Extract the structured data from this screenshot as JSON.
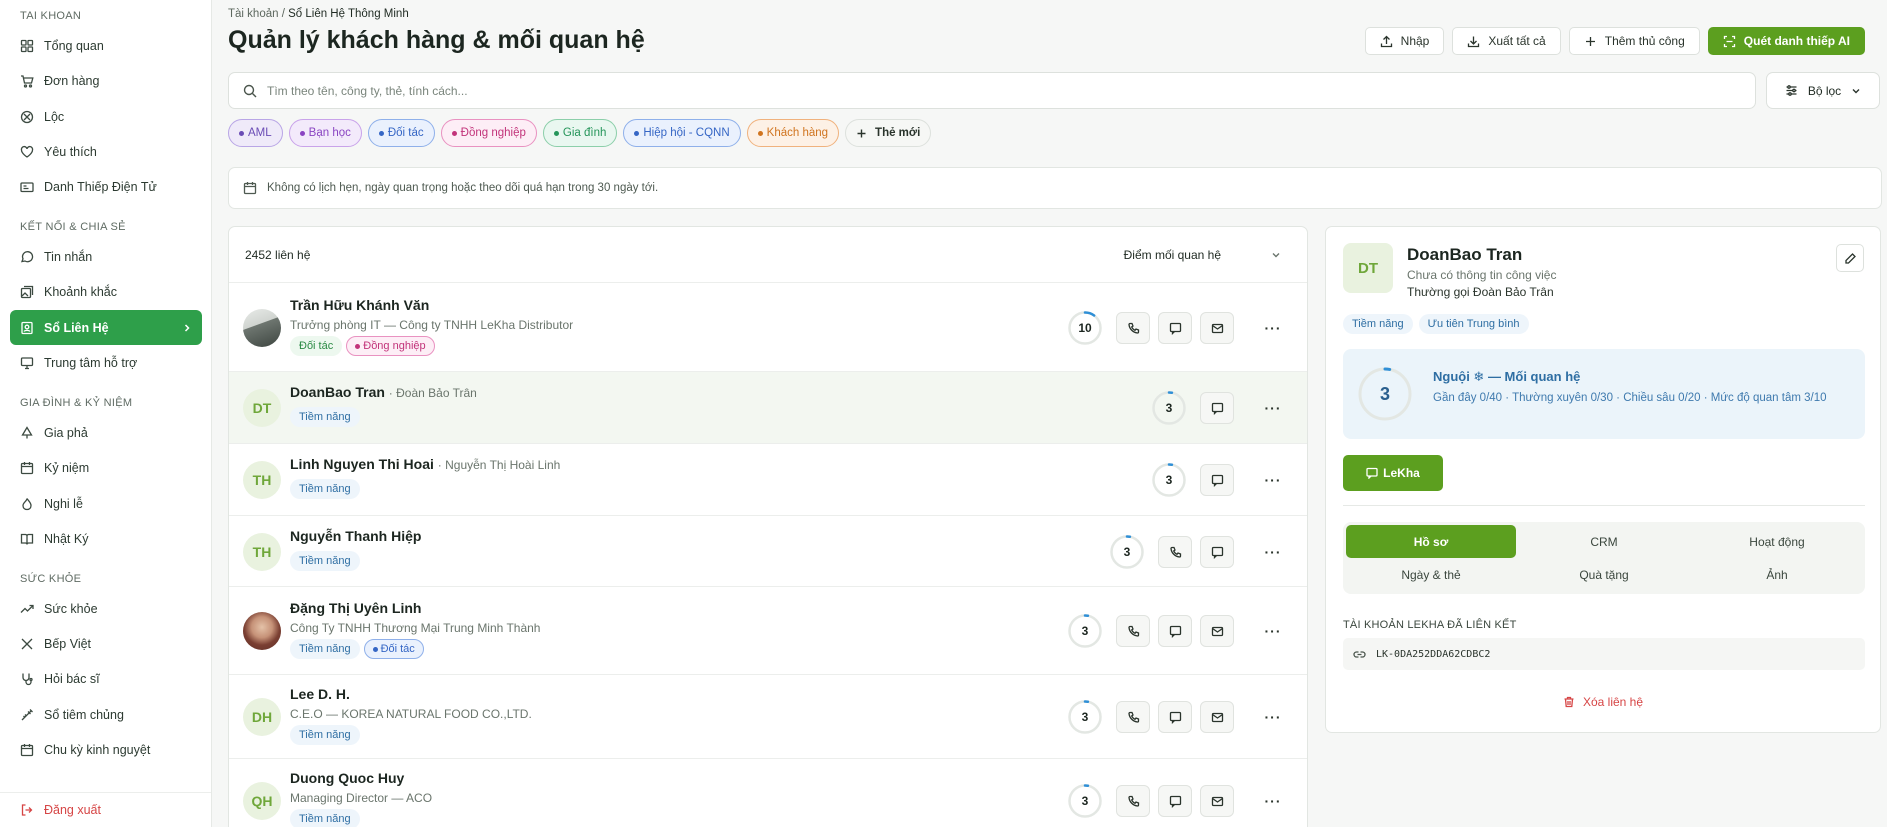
{
  "sidebar": {
    "sections": [
      {
        "title": "TAI KHOAN",
        "items": [
          "Tổng quan",
          "Đơn hàng",
          "Lộc",
          "Yêu thích",
          "Danh Thiếp Điện Tử"
        ]
      },
      {
        "title": "KẾT NỐI & CHIA SẺ",
        "items": [
          "Tin nhắn",
          "Khoảnh khắc",
          "Sổ Liên Hệ",
          "Trung tâm hỗ trợ"
        ]
      },
      {
        "title": "GIA ĐÌNH & KỶ NIỆM",
        "items": [
          "Gia phả",
          "Kỷ niệm",
          "Nghi lễ",
          "Nhật Ký"
        ]
      },
      {
        "title": "SỨC KHỎE",
        "items": [
          "Sức khỏe",
          "Bếp Việt",
          "Hỏi bác sĩ",
          "Sổ tiêm chủng",
          "Chu kỳ kinh nguyệt"
        ]
      }
    ],
    "active_item": "Sổ Liên Hệ",
    "logout": "Đăng xuất"
  },
  "header": {
    "breadcrumb_root": "Tài khoản",
    "breadcrumb_sep": " / ",
    "breadcrumb_current": "Sổ Liên Hệ Thông Minh",
    "title": "Quản lý khách hàng & mối quan hệ",
    "actions": {
      "import": "Nhập",
      "export_all": "Xuất tất cả",
      "add_manual": "Thêm thủ công",
      "scan_ai": "Quét danh thiếp AI"
    }
  },
  "search": {
    "placeholder": "Tìm theo tên, công ty, thẻ, tính cách...",
    "filter_label": "Bộ lọc"
  },
  "tags": [
    {
      "label": "AML",
      "bg": "#efeaf9",
      "border": "#b9a6e6",
      "color": "#6a4cb5"
    },
    {
      "label": "Bạn học",
      "bg": "#f3eafb",
      "border": "#c9a3ea",
      "color": "#8a45c2"
    },
    {
      "label": "Đối tác",
      "bg": "#eaf1fd",
      "border": "#8fb0ea",
      "color": "#3566c5"
    },
    {
      "label": "Đồng nghiệp",
      "bg": "#fdeef6",
      "border": "#e992c1",
      "color": "#c2337a"
    },
    {
      "label": "Gia đình",
      "bg": "#e9f7f0",
      "border": "#8ccfaa",
      "color": "#25955a"
    },
    {
      "label": "Hiệp hội - CQNN",
      "bg": "#eaf1fd",
      "border": "#8fb0ea",
      "color": "#3566c5"
    },
    {
      "label": "Khách hàng",
      "bg": "#fdf1e6",
      "border": "#f0b27e",
      "color": "#d0741f"
    }
  ],
  "new_tag_label": "Thẻ mới",
  "notice": "Không có lịch hẹn, ngày quan trọng hoặc theo dõi quá hạn trong 30 ngày tới.",
  "list": {
    "count_label": "2452 liên hệ",
    "sort_label": "Điểm mối quan hệ",
    "contacts": [
      {
        "name": "Trần Hữu Khánh Văn",
        "alias": "",
        "initials": "",
        "photo": "photo1",
        "subtitle": "Trưởng phòng IT — Công ty TNHH LeKha Distributor",
        "tags": [
          {
            "label": "Đối tác",
            "cls": "dt",
            "dot": false
          },
          {
            "label": "Đồng nghiệp",
            "cls": "dn",
            "dot": true
          }
        ],
        "score": "10",
        "score_fraction": 0.1,
        "phone": true,
        "email": true
      },
      {
        "name": "DoanBao Tran",
        "alias": "· Đoàn Bảo Trân",
        "initials": "DT",
        "photo": "",
        "subtitle": "",
        "tags": [
          {
            "label": "Tiềm năng",
            "cls": "tn",
            "dot": false
          }
        ],
        "score": "3",
        "score_fraction": 0.03,
        "phone": false,
        "email": false
      },
      {
        "name": "Linh Nguyen Thi Hoai",
        "alias": "· Nguyễn Thị Hoài Linh",
        "initials": "TH",
        "photo": "",
        "subtitle": "",
        "tags": [
          {
            "label": "Tiềm năng",
            "cls": "tn",
            "dot": false
          }
        ],
        "score": "3",
        "score_fraction": 0.03,
        "phone": false,
        "email": false
      },
      {
        "name": "Nguyễn Thanh Hiệp",
        "alias": "",
        "initials": "TH",
        "photo": "",
        "subtitle": "",
        "tags": [
          {
            "label": "Tiềm năng",
            "cls": "tn",
            "dot": false
          }
        ],
        "score": "3",
        "score_fraction": 0.03,
        "phone": true,
        "email": false
      },
      {
        "name": "Đặng Thị Uyên Linh",
        "alias": "",
        "initials": "",
        "photo": "photo2",
        "subtitle": "Công Ty TNHH Thương Mại Trung Minh Thành",
        "tags": [
          {
            "label": "Tiềm năng",
            "cls": "tn",
            "dot": false
          },
          {
            "label": "Đối tác",
            "cls": "dt2",
            "dot": true
          }
        ],
        "score": "3",
        "score_fraction": 0.03,
        "phone": true,
        "email": true
      },
      {
        "name": "Lee D. H.",
        "alias": "",
        "initials": "DH",
        "photo": "",
        "subtitle": "C.E.O — KOREA NATURAL FOOD CO.,LTD.",
        "tags": [
          {
            "label": "Tiềm năng",
            "cls": "tn",
            "dot": false
          }
        ],
        "score": "3",
        "score_fraction": 0.03,
        "phone": true,
        "email": true
      },
      {
        "name": "Duong Quoc Huy",
        "alias": "",
        "initials": "QH",
        "photo": "",
        "subtitle": "Managing Director — ACO",
        "tags": [
          {
            "label": "Tiềm năng",
            "cls": "tn",
            "dot": false
          }
        ],
        "score": "3",
        "score_fraction": 0.03,
        "phone": true,
        "email": true
      }
    ]
  },
  "detail": {
    "initials": "DT",
    "name": "DoanBao Tran",
    "job": "Chưa có thông tin công việc",
    "call_name": "Thường gọi Đoàn Bảo Trân",
    "tags": [
      "Tiềm năng",
      "Ưu tiên Trung bình"
    ],
    "rel_score": "3",
    "rel_title": "Nguội ❄ — Mối quan hệ",
    "rel_desc": "Gần đây 0/40 · Thường xuyên 0/30 · Chiều sâu 0/20 · Mức độ quan tâm 3/10",
    "chat_label": "LeKha",
    "tabs": [
      "Hồ sơ",
      "CRM",
      "Hoạt động",
      "Ngày & thẻ",
      "Quà tặng",
      "Ảnh"
    ],
    "linked_label": "TÀI KHOẢN LEKHA ĐÃ LIÊN KẾT",
    "linked_id": "LK-0DA252DDA62CDBC2",
    "delete_label": "Xóa liên hệ"
  },
  "colors": {
    "accent": "#5c9f1f",
    "sidebar_active": "#2e9f4a",
    "danger": "#d64545",
    "score_ring": "#2f8fd6"
  }
}
